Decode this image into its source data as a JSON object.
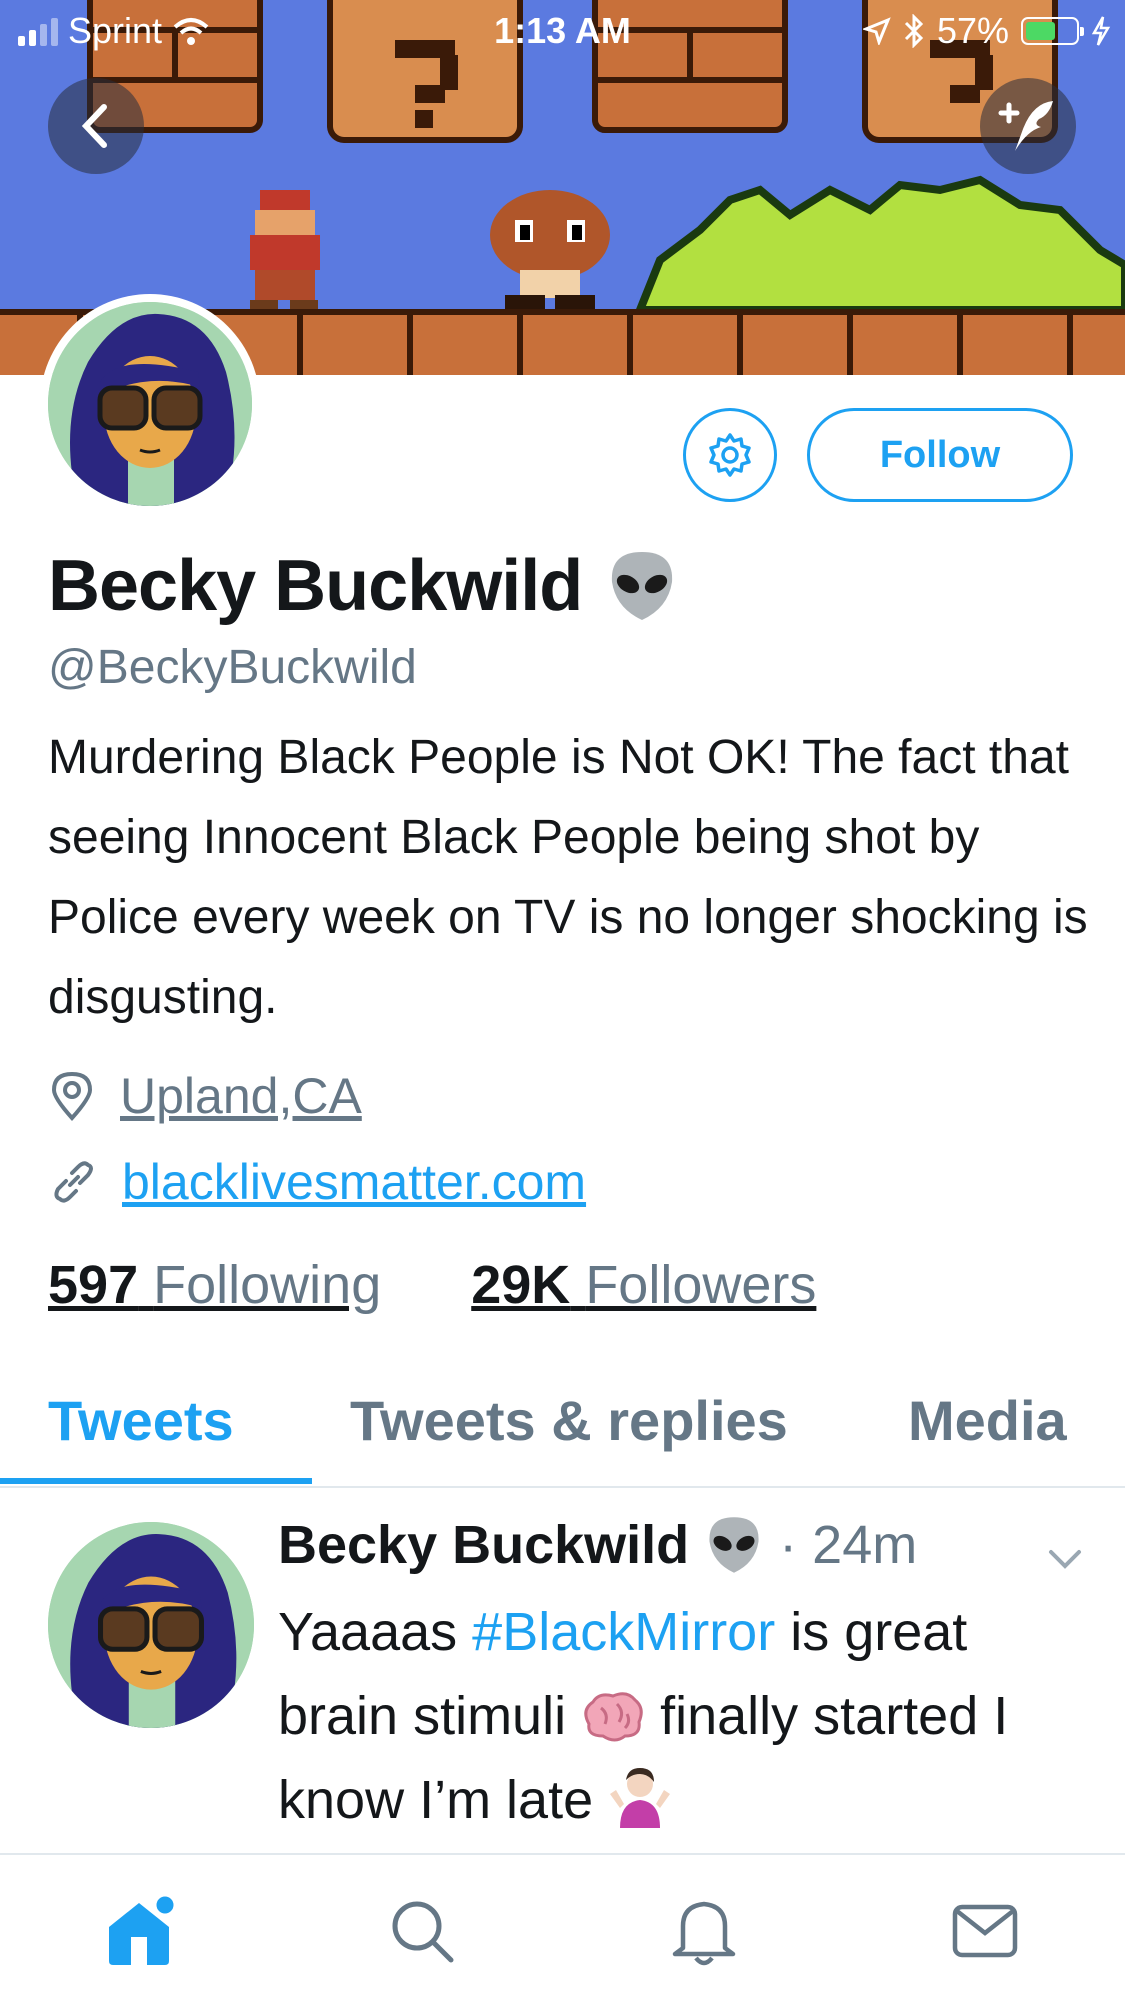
{
  "status_bar": {
    "carrier": "Sprint",
    "time": "1:13 AM",
    "battery": "57%",
    "battery_level": 0.57
  },
  "profile": {
    "name": "Becky Buckwild",
    "handle": "@BeckyBuckwild",
    "bio": "Murdering Black People is Not OK! The fact that seeing Innocent Black People being shot by Police every week on TV is no longer shocking is disgusting.",
    "location": "Upland,CA",
    "website": "blacklivesmatter.com",
    "following_count": "597",
    "following_label": "Following",
    "followers_count": "29K",
    "followers_label": "Followers",
    "follow_button": "Follow"
  },
  "tabs": [
    "Tweets",
    "Tweets & replies",
    "Media"
  ],
  "tweet": {
    "author": "Becky Buckwild",
    "time": "· 24m",
    "text_1": "Yaaaas ",
    "hashtag": "#BlackMirror",
    "text_2": " is great brain stimuli ",
    "text_3": " finally started I know I’m late "
  },
  "colors": {
    "accent": "#1da1f2",
    "secondary_text": "#657786",
    "primary_text": "#14171a"
  },
  "icons": [
    "back-icon",
    "compose-icon",
    "settings-icon",
    "location-icon",
    "link-icon",
    "alien-emoji",
    "brain-emoji",
    "shrug-emoji",
    "home-icon",
    "search-icon",
    "notifications-icon",
    "messages-icon"
  ]
}
